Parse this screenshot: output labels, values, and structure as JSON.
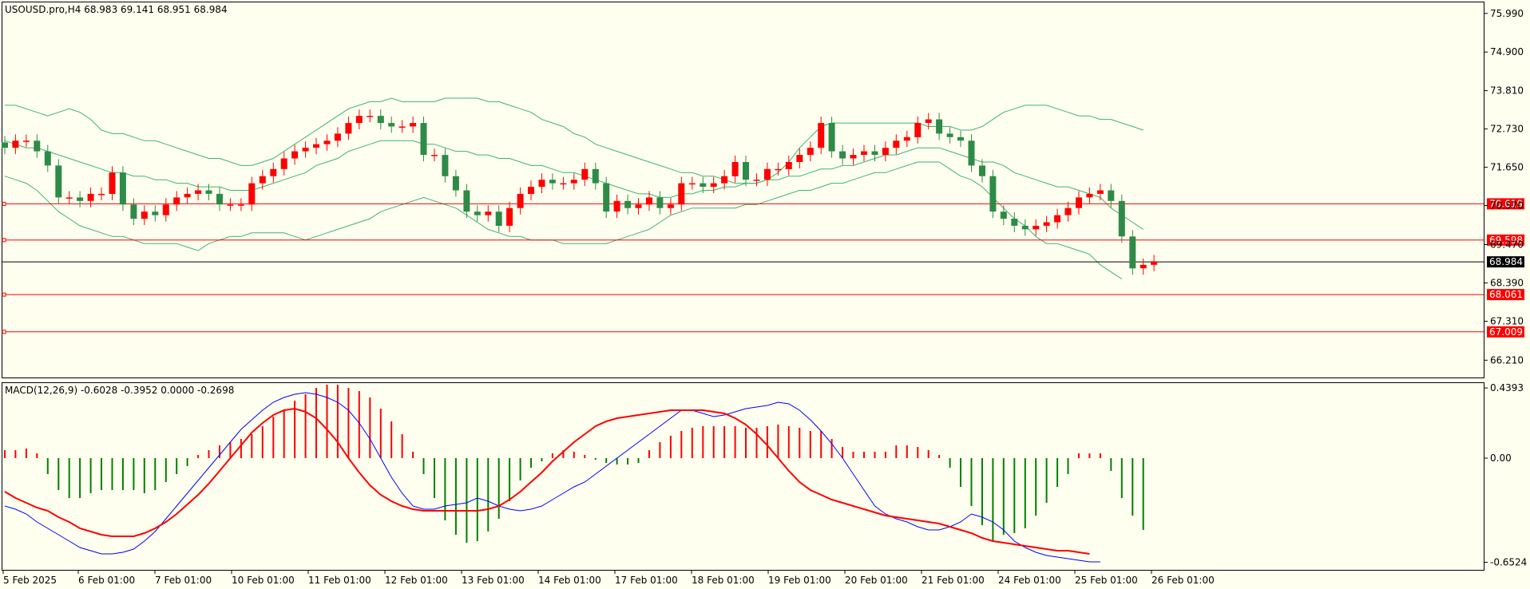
{
  "chart_data": [
    {
      "type": "candlestick",
      "title": "USOUSD.pro,H4  68.983 69.141 68.951 68.984",
      "symbol": "USOUSD.pro",
      "timeframe": "H4",
      "ohlc_label": "68.983 69.141 68.951 68.984",
      "ylim": [
        65.7,
        76.3
      ],
      "y_ticks": [
        "75.990",
        "74.900",
        "73.810",
        "72.730",
        "71.650",
        "70.570",
        "69.470",
        "68.390",
        "67.310",
        "66.210"
      ],
      "x_ticks": [
        "5 Feb 2025",
        "6 Feb 01:00",
        "7 Feb 01:00",
        "10 Feb 01:00",
        "11 Feb 01:00",
        "12 Feb 01:00",
        "13 Feb 01:00",
        "14 Feb 01:00",
        "17 Feb 01:00",
        "18 Feb 01:00",
        "19 Feb 01:00",
        "20 Feb 01:00",
        "21 Feb 01:00",
        "24 Feb 01:00",
        "25 Feb 01:00",
        "26 Feb 01:00"
      ],
      "close": [
        72.2,
        72.4,
        72.4,
        72.1,
        71.7,
        70.8,
        70.8,
        70.7,
        70.9,
        70.9,
        71.5,
        70.6,
        70.2,
        70.4,
        70.3,
        70.6,
        70.8,
        70.9,
        71.0,
        70.9,
        70.6,
        70.6,
        70.6,
        71.2,
        71.4,
        71.6,
        71.9,
        72.1,
        72.2,
        72.3,
        72.4,
        72.6,
        72.9,
        73.1,
        73.1,
        72.9,
        72.8,
        72.8,
        72.9,
        72.0,
        72.0,
        71.4,
        71.0,
        70.4,
        70.3,
        70.4,
        70.0,
        70.5,
        70.9,
        71.1,
        71.3,
        71.2,
        71.2,
        71.3,
        71.6,
        71.2,
        70.4,
        70.7,
        70.5,
        70.6,
        70.8,
        70.5,
        70.6,
        71.2,
        71.2,
        71.1,
        71.2,
        71.4,
        71.8,
        71.3,
        71.3,
        71.6,
        71.6,
        71.8,
        72.0,
        72.2,
        72.9,
        72.1,
        71.9,
        72.0,
        72.1,
        72.0,
        72.2,
        72.4,
        72.5,
        72.9,
        73.0,
        72.6,
        72.5,
        72.4,
        71.7,
        71.4,
        70.4,
        70.2,
        70.0,
        69.9,
        70.0,
        70.1,
        70.3,
        70.5,
        70.8,
        70.9,
        71.0,
        70.7,
        69.7,
        68.8,
        68.9,
        69.0
      ],
      "upper_band": [
        73.4,
        73.4,
        73.3,
        73.2,
        73.1,
        73.2,
        73.3,
        73.2,
        73.0,
        72.7,
        72.6,
        72.6,
        72.5,
        72.4,
        72.4,
        72.3,
        72.2,
        72.1,
        72.0,
        71.9,
        71.9,
        71.8,
        71.7,
        71.7,
        71.8,
        71.9,
        72.1,
        72.3,
        72.5,
        72.7,
        72.9,
        73.1,
        73.3,
        73.4,
        73.5,
        73.5,
        73.6,
        73.5,
        73.5,
        73.5,
        73.5,
        73.6,
        73.6,
        73.6,
        73.6,
        73.5,
        73.5,
        73.4,
        73.3,
        73.2,
        73.0,
        72.9,
        72.8,
        72.6,
        72.5,
        72.3,
        72.2,
        72.1,
        72.0,
        71.9,
        71.8,
        71.7,
        71.6,
        71.5,
        71.5,
        71.4,
        71.4,
        71.3,
        71.2,
        71.2,
        71.2,
        71.3,
        71.5,
        71.8,
        72.2,
        72.5,
        72.8,
        72.9,
        72.9,
        72.9,
        72.9,
        72.9,
        72.9,
        72.9,
        72.9,
        72.9,
        72.8,
        72.8,
        72.8,
        72.7,
        72.7,
        72.8,
        73.0,
        73.2,
        73.3,
        73.4,
        73.4,
        73.4,
        73.3,
        73.2,
        73.1,
        73.1,
        73.0,
        73.0,
        72.9,
        72.8,
        72.7
      ],
      "middle_band": [
        72.4,
        72.3,
        72.2,
        72.2,
        72.1,
        72.0,
        71.9,
        71.8,
        71.7,
        71.6,
        71.5,
        71.5,
        71.4,
        71.4,
        71.3,
        71.3,
        71.2,
        71.2,
        71.1,
        71.1,
        71.1,
        71.0,
        71.0,
        71.0,
        71.1,
        71.2,
        71.3,
        71.4,
        71.5,
        71.7,
        71.8,
        71.9,
        72.1,
        72.2,
        72.3,
        72.4,
        72.4,
        72.4,
        72.4,
        72.3,
        72.3,
        72.2,
        72.1,
        72.1,
        72.0,
        72.0,
        71.9,
        71.9,
        71.8,
        71.7,
        71.7,
        71.6,
        71.5,
        71.5,
        71.4,
        71.3,
        71.2,
        71.1,
        71.0,
        70.9,
        70.9,
        70.8,
        70.8,
        70.9,
        70.9,
        71.0,
        71.0,
        71.1,
        71.1,
        71.2,
        71.2,
        71.3,
        71.3,
        71.4,
        71.4,
        71.5,
        71.6,
        71.6,
        71.7,
        71.7,
        71.8,
        71.9,
        72.0,
        72.0,
        72.1,
        72.2,
        72.2,
        72.2,
        72.1,
        72.0,
        71.9,
        71.8,
        71.8,
        71.7,
        71.5,
        71.4,
        71.3,
        71.2,
        71.1,
        71.1,
        71.0,
        70.9,
        70.8,
        70.5,
        70.3,
        70.1,
        69.9
      ],
      "lower_band": [
        71.4,
        71.3,
        71.2,
        71.0,
        70.7,
        70.4,
        70.2,
        70.0,
        69.9,
        69.8,
        69.7,
        69.7,
        69.6,
        69.5,
        69.5,
        69.5,
        69.5,
        69.4,
        69.3,
        69.5,
        69.6,
        69.7,
        69.7,
        69.8,
        69.8,
        69.8,
        69.8,
        69.7,
        69.6,
        69.7,
        69.8,
        69.9,
        70.0,
        70.1,
        70.2,
        70.4,
        70.5,
        70.6,
        70.7,
        70.8,
        70.7,
        70.6,
        70.5,
        70.3,
        70.1,
        69.9,
        69.8,
        69.7,
        69.7,
        69.6,
        69.6,
        69.6,
        69.5,
        69.5,
        69.5,
        69.5,
        69.5,
        69.6,
        69.7,
        69.8,
        69.9,
        70.1,
        70.3,
        70.4,
        70.5,
        70.5,
        70.5,
        70.5,
        70.5,
        70.6,
        70.6,
        70.7,
        70.8,
        70.9,
        71.0,
        71.0,
        71.1,
        71.2,
        71.2,
        71.3,
        71.4,
        71.5,
        71.5,
        71.6,
        71.7,
        71.8,
        71.8,
        71.8,
        71.6,
        71.4,
        71.3,
        71.1,
        70.8,
        70.5,
        70.2,
        70.0,
        69.7,
        69.5,
        69.5,
        69.4,
        69.3,
        69.2,
        68.9,
        68.7,
        68.5
      ],
      "horizontal_levels": [
        {
          "label": "70.619",
          "value": 70.619,
          "color": "#ff0000"
        },
        {
          "label": "69.598",
          "value": 69.598,
          "color": "#ff0000"
        },
        {
          "label": "68.984",
          "value": 68.984,
          "color": "#000000",
          "current_price": true
        },
        {
          "label": "68.061",
          "value": 68.061,
          "color": "#ff0000"
        },
        {
          "label": "67.009",
          "value": 67.009,
          "color": "#ff0000"
        }
      ],
      "colors": {
        "bull": "#ff0000",
        "bear": "#2e8b47",
        "bands": "#3cb371",
        "level": "#ff0000",
        "background": "#fffff0"
      }
    },
    {
      "type": "macd",
      "title": "MACD(12,26,9) -0.6028 -0.3952 0.0000 -0.2698",
      "label": "MACD(12,26,9) -0.6028 -0.3952 0.0000 -0.2698",
      "ylim": [
        -0.7,
        0.47
      ],
      "y_ticks": [
        "0.4393",
        "0.00",
        "-0.6524"
      ],
      "histogram": [
        0.05,
        0.05,
        0.06,
        0.03,
        -0.1,
        -0.2,
        -0.25,
        -0.25,
        -0.22,
        -0.2,
        -0.2,
        -0.2,
        -0.2,
        -0.22,
        -0.2,
        -0.15,
        -0.1,
        -0.05,
        0.02,
        0.05,
        0.08,
        0.1,
        0.12,
        0.15,
        0.2,
        0.26,
        0.3,
        0.36,
        0.4,
        0.44,
        0.46,
        0.46,
        0.44,
        0.42,
        0.38,
        0.31,
        0.23,
        0.15,
        0.04,
        -0.1,
        -0.25,
        -0.39,
        -0.48,
        -0.53,
        -0.52,
        -0.46,
        -0.38,
        -0.27,
        -0.14,
        -0.06,
        -0.02,
        0.03,
        0.05,
        0.04,
        0.02,
        -0.01,
        -0.03,
        -0.04,
        -0.04,
        -0.03,
        0.05,
        0.1,
        0.14,
        0.17,
        0.19,
        0.2,
        0.2,
        0.2,
        0.2,
        0.19,
        0.19,
        0.2,
        0.21,
        0.2,
        0.19,
        0.17,
        0.17,
        0.12,
        0.07,
        0.04,
        0.04,
        0.04,
        0.04,
        0.08,
        0.08,
        0.07,
        0.05,
        0.02,
        -0.06,
        -0.18,
        -0.3,
        -0.42,
        -0.52,
        -0.48,
        -0.47,
        -0.44,
        -0.36,
        -0.28,
        -0.18,
        -0.1,
        0.03,
        0.03,
        0.03,
        -0.08,
        -0.25,
        -0.36,
        -0.45
      ],
      "macd_line": [
        -0.3,
        -0.32,
        -0.35,
        -0.4,
        -0.44,
        -0.48,
        -0.52,
        -0.56,
        -0.58,
        -0.6,
        -0.6,
        -0.59,
        -0.57,
        -0.52,
        -0.46,
        -0.38,
        -0.3,
        -0.22,
        -0.14,
        -0.06,
        0.02,
        0.1,
        0.18,
        0.24,
        0.3,
        0.35,
        0.38,
        0.4,
        0.41,
        0.4,
        0.38,
        0.35,
        0.3,
        0.22,
        0.12,
        0.0,
        -0.12,
        -0.22,
        -0.3,
        -0.32,
        -0.32,
        -0.3,
        -0.29,
        -0.28,
        -0.25,
        -0.27,
        -0.3,
        -0.32,
        -0.33,
        -0.32,
        -0.3,
        -0.26,
        -0.22,
        -0.18,
        -0.15,
        -0.1,
        -0.05,
        0.0,
        0.05,
        0.1,
        0.15,
        0.2,
        0.25,
        0.3,
        0.3,
        0.28,
        0.26,
        0.27,
        0.29,
        0.31,
        0.32,
        0.33,
        0.35,
        0.34,
        0.3,
        0.24,
        0.17,
        0.09,
        0.0,
        -0.1,
        -0.2,
        -0.3,
        -0.35,
        -0.38,
        -0.4,
        -0.43,
        -0.45,
        -0.45,
        -0.43,
        -0.4,
        -0.35,
        -0.37,
        -0.4,
        -0.45,
        -0.52,
        -0.56,
        -0.59,
        -0.61,
        -0.62,
        -0.63,
        -0.64,
        -0.65,
        -0.65
      ],
      "signal_line": [
        -0.21,
        -0.25,
        -0.28,
        -0.31,
        -0.33,
        -0.37,
        -0.4,
        -0.44,
        -0.46,
        -0.48,
        -0.49,
        -0.49,
        -0.49,
        -0.47,
        -0.44,
        -0.4,
        -0.35,
        -0.29,
        -0.23,
        -0.16,
        -0.08,
        0.0,
        0.08,
        0.16,
        0.22,
        0.27,
        0.3,
        0.31,
        0.29,
        0.25,
        0.18,
        0.1,
        0.0,
        -0.09,
        -0.17,
        -0.23,
        -0.27,
        -0.3,
        -0.32,
        -0.33,
        -0.33,
        -0.33,
        -0.33,
        -0.33,
        -0.33,
        -0.32,
        -0.3,
        -0.26,
        -0.21,
        -0.15,
        -0.09,
        -0.02,
        0.04,
        0.1,
        0.15,
        0.2,
        0.23,
        0.25,
        0.26,
        0.27,
        0.28,
        0.29,
        0.3,
        0.3,
        0.3,
        0.3,
        0.29,
        0.28,
        0.25,
        0.21,
        0.15,
        0.08,
        0.0,
        -0.08,
        -0.15,
        -0.2,
        -0.23,
        -0.26,
        -0.28,
        -0.3,
        -0.32,
        -0.34,
        -0.36,
        -0.37,
        -0.38,
        -0.39,
        -0.4,
        -0.41,
        -0.43,
        -0.45,
        -0.47,
        -0.5,
        -0.52,
        -0.53,
        -0.54,
        -0.55,
        -0.56,
        -0.57,
        -0.58,
        -0.58,
        -0.59,
        -0.6
      ],
      "colors": {
        "positive": "#ff0000",
        "negative": "#008000",
        "macd": "#0000ff",
        "signal": "#ff0000"
      }
    }
  ]
}
